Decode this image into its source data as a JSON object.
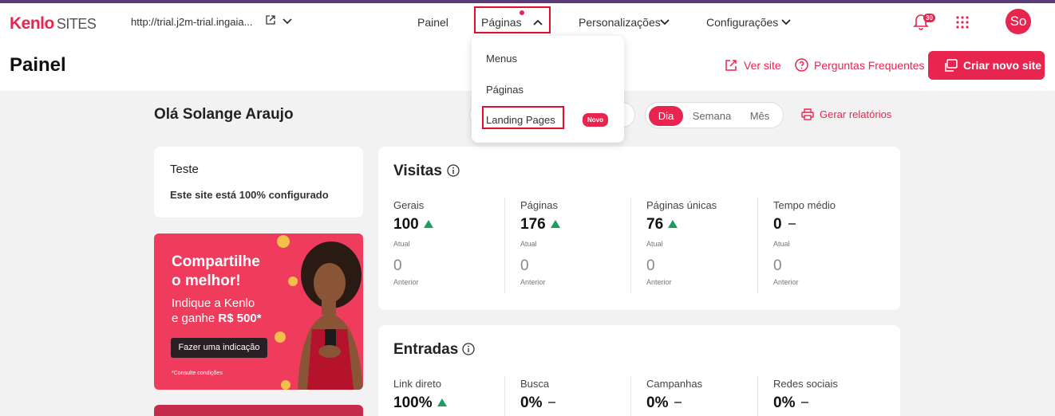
{
  "header": {
    "logo_brand": "Kenlo",
    "logo_product": "SITES",
    "site_url": "http://trial.j2m-trial.ingaia...",
    "nav": {
      "painel": "Painel",
      "paginas": "Páginas",
      "personalizacoes": "Personalizações",
      "configuracoes": "Configurações"
    },
    "notifications_count": "30",
    "avatar_initials": "So"
  },
  "page": {
    "title": "Painel",
    "ver_site": "Ver site",
    "perguntas": "Perguntas Frequentes",
    "criar": "Criar novo site"
  },
  "dropdown": {
    "items": [
      "Menus",
      "Páginas",
      "Landing Pages"
    ],
    "badge": "Novo"
  },
  "dashboard": {
    "greeting": "Olá Solange Araujo",
    "periods": [
      "Dia",
      "Semana",
      "Mês"
    ],
    "active_period": "Dia",
    "relatorios": "Gerar relatórios"
  },
  "teste_card": {
    "title": "Teste",
    "subtitle": "Este site está 100% configurado"
  },
  "promo": {
    "headline_1": "Compartilhe",
    "headline_2": "o melhor!",
    "body_1": "Indique a Kenlo",
    "body_2_prefix": "e ganhe ",
    "body_2_bold": "R$ 500*",
    "button": "Fazer uma indicação",
    "note": "*Consulte condições"
  },
  "visitas": {
    "title": "Visitas",
    "current_label": "Atual",
    "previous_label": "Anterior",
    "metrics": [
      {
        "label": "Gerais",
        "value": "100",
        "trend": "up",
        "previous": "0"
      },
      {
        "label": "Páginas",
        "value": "176",
        "trend": "up",
        "previous": "0"
      },
      {
        "label": "Páginas únicas",
        "value": "76",
        "trend": "up",
        "previous": "0"
      },
      {
        "label": "Tempo médio",
        "value": "0",
        "trend": "flat",
        "previous": "0"
      }
    ]
  },
  "entradas": {
    "title": "Entradas",
    "metrics": [
      {
        "label": "Link direto",
        "value": "100%",
        "trend": "up"
      },
      {
        "label": "Busca",
        "value": "0%",
        "trend": "flat"
      },
      {
        "label": "Campanhas",
        "value": "0%",
        "trend": "flat"
      },
      {
        "label": "Redes sociais",
        "value": "0%",
        "trend": "flat"
      }
    ]
  },
  "colors": {
    "accent": "#e8254f",
    "highlight_box": "#e0102c",
    "trend_up": "#1a9e5c"
  }
}
